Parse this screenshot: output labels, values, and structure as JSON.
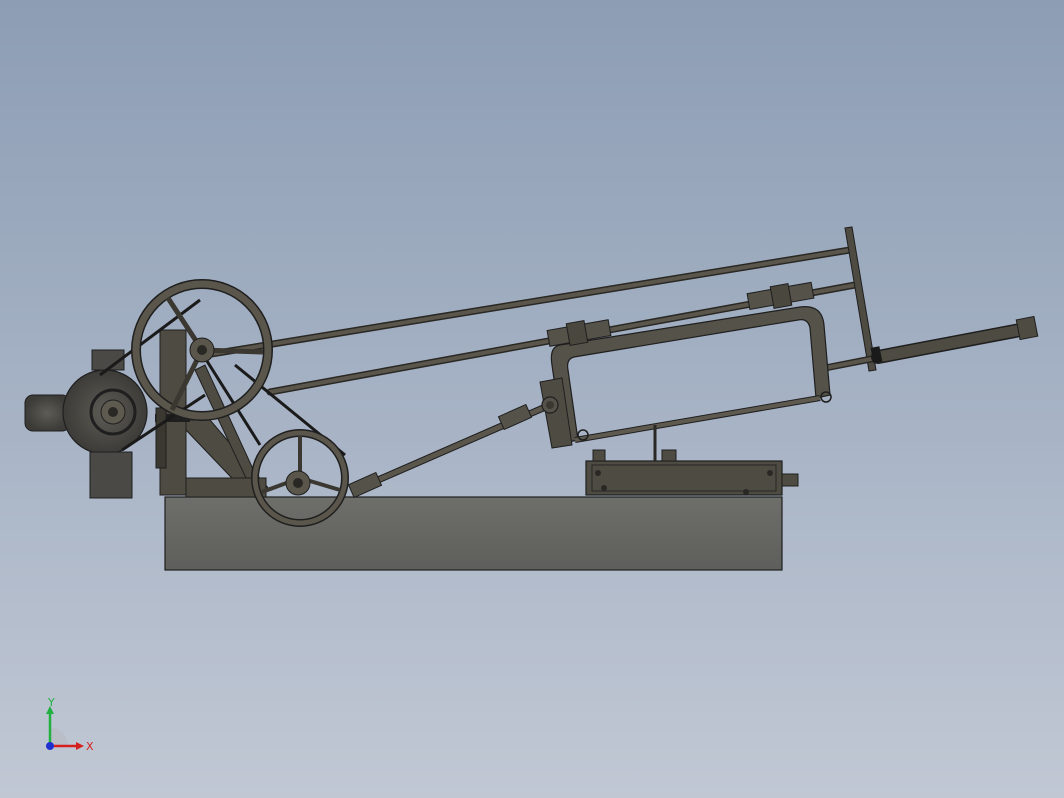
{
  "viewport": {
    "background_top": "#8d9db4",
    "background_bottom": "#c1c8d4"
  },
  "model": {
    "part_color": "#5e5a4e",
    "part_dark": "#3a3830",
    "edge_color": "#1f1f1f",
    "base_color": "#6a6a66"
  },
  "triad": {
    "x_label": "X",
    "y_label": "Y",
    "x_color": "#d62020",
    "y_color": "#20b040",
    "z_color": "#2030d0"
  }
}
